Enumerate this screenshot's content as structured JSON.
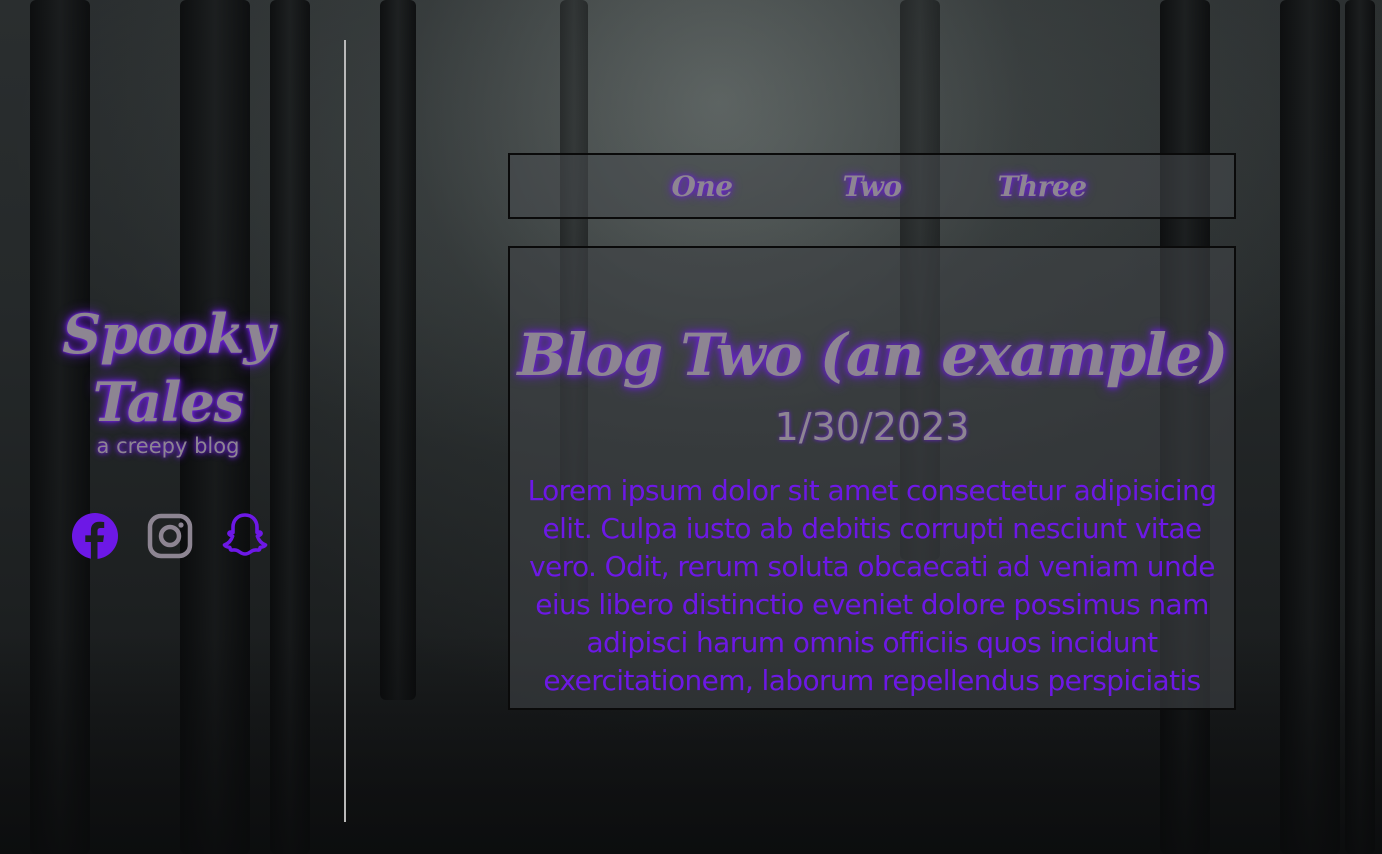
{
  "brand": {
    "title_line1": "Spooky",
    "title_line2": "Tales",
    "subtitle": "a creepy blog"
  },
  "socials": [
    {
      "icon": "facebook-icon",
      "color": "#6d18e6"
    },
    {
      "icon": "instagram-icon",
      "color": "#8d8592"
    },
    {
      "icon": "snapchat-icon",
      "color": "#6d18e6"
    }
  ],
  "nav": {
    "items": [
      "One",
      "Two",
      "Three"
    ]
  },
  "post": {
    "title": "Blog Two (an example)",
    "date": "1/30/2023",
    "body": "Lorem ipsum dolor sit amet consectetur adipisicing elit. Culpa iusto ab debitis corrupti nesciunt vitae vero. Odit, rerum soluta obcaecati ad veniam unde eius libero distinctio eveniet dolore possimus nam adipisci harum omnis officiis quos incidunt exercitationem, laborum repellendus perspiciatis"
  },
  "colors": {
    "accent": "#6d18e6",
    "glow": "#6a1fd6",
    "text_muted": "#8d8592",
    "divider": "#b9b9b9"
  }
}
